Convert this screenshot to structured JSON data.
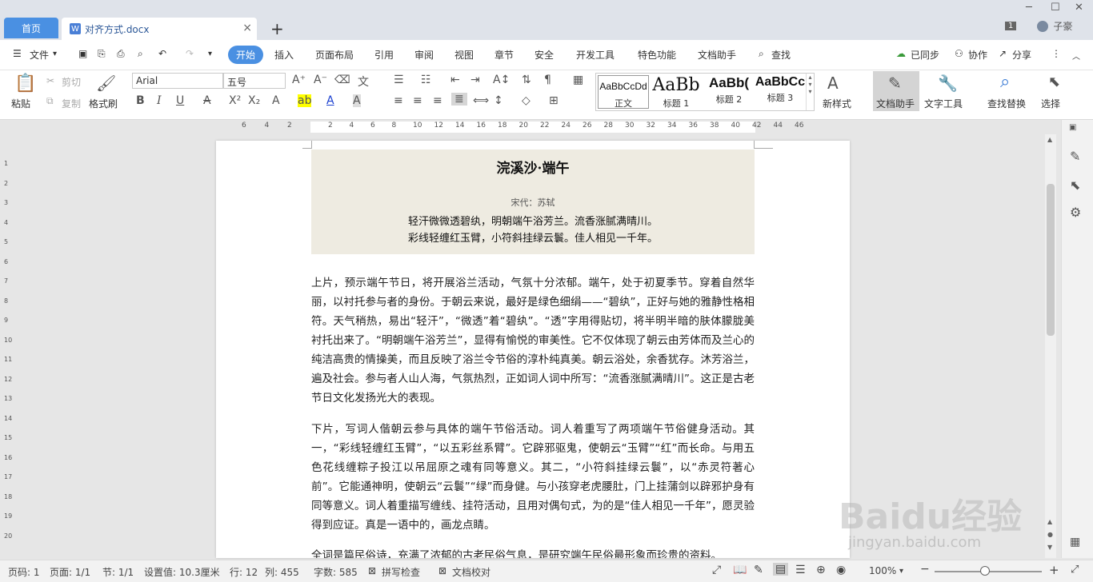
{
  "tabs": {
    "home": "首页",
    "doc": "对齐方式.docx",
    "close": "×",
    "plus": "+"
  },
  "window": {
    "badge": "1",
    "user": "子豪"
  },
  "menu": {
    "file": "文件",
    "items": [
      "开始",
      "插入",
      "页面布局",
      "引用",
      "审阅",
      "视图",
      "章节",
      "安全",
      "开发工具",
      "特色功能",
      "文档助手"
    ],
    "search": "查找",
    "sync": "已同步",
    "collab": "协作",
    "share": "分享"
  },
  "ribbon": {
    "paste": "粘贴",
    "cut": "剪切",
    "copy": "复制",
    "format_painter": "格式刷",
    "font": "Arial",
    "size": "五号",
    "styles": [
      {
        "preview": "AaBbCcDd",
        "label": "正文"
      },
      {
        "preview": "AaBb",
        "label": "标题 1"
      },
      {
        "preview": "AaBb(",
        "label": "标题 2"
      },
      {
        "preview": "AaBbCc",
        "label": "标题 3"
      }
    ],
    "new_style": "新样式",
    "doc_assistant": "文档助手",
    "text_tools": "文字工具",
    "find_replace": "查找替换",
    "select": "选择"
  },
  "ruler": {
    "h": [
      "6",
      "4",
      "2",
      "2",
      "4",
      "6",
      "8",
      "10",
      "12",
      "14",
      "16",
      "18",
      "20",
      "22",
      "24",
      "26",
      "28",
      "30",
      "32",
      "34",
      "36",
      "38",
      "40",
      "42",
      "44",
      "46"
    ],
    "v": [
      "1",
      "2",
      "3",
      "4",
      "5",
      "6",
      "7",
      "8",
      "9",
      "10",
      "11",
      "12",
      "13",
      "14",
      "15",
      "16",
      "17",
      "18",
      "19",
      "20"
    ]
  },
  "doc": {
    "title": "浣溪沙·端午",
    "author": "宋代：苏轼",
    "lines": [
      "轻汗微微透碧纨，明朝端午浴芳兰。流香涨腻满晴川。",
      "彩线轻缠红玉臂，小符斜挂绿云鬟。佳人相见一千年。"
    ],
    "p1": "上片，预示端午节日，将开展浴兰活动，气氛十分浓郁。端午，处于初夏季节。穿着自然华丽，以衬托参与者的身份。于朝云来说，最好是绿色细绢——“碧纨”，正好与她的雅静性格相符。天气稍热，易出“轻汗”，“微透”着“碧纨”。“透”字用得贴切，将半明半暗的肤体朦胧美衬托出来了。“明朝端午浴芳兰”，显得有愉悦的审美性。它不仅体现了朝云由芳体而及兰心的纯洁高贵的情操美，而且反映了浴兰令节俗的淳朴纯真美。朝云浴处，余香犹存。沐芳浴兰，遍及社会。参与者人山人海，气氛热烈，正如词人词中所写：“流香涨腻满晴川”。这正是古老节日文化发扬光大的表现。",
    "p2": "下片，写词人偕朝云参与具体的端午节俗活动。词人着重写了两项端午节俗健身活动。其一，“彩线轻缠红玉臂”，“以五彩丝系臂”。它辟邪驱鬼，使朝云“玉臂”“红”而长命。与用五色花线缠粽子投江以吊屈原之魂有同等意义。其二，“小符斜挂绿云鬟”，以“赤灵符著心前”。它能通神明，使朝云“云鬟”“绿”而身健。与小孩穿老虎腰肚，门上挂蒲剑以辟邪护身有同等意义。词人着重描写缠线、挂符活动，且用对偶句式，为的是“佳人相见一千年”，愿灵验得到应证。真是一语中的，画龙点睛。",
    "p3": "全词是篇民俗诗，充满了浓郁的古老民俗气息，是研究端午民俗最形象而珍贵的资料。"
  },
  "status": {
    "page": "页码: 1",
    "pages": "页面: 1/1",
    "section": "节: 1/1",
    "setting": "设置值: 10.3厘米",
    "row": "行: 12",
    "col": "列: 455",
    "words": "字数: 585",
    "spell": "拼写检查",
    "proof": "文档校对",
    "zoom": "100%"
  },
  "watermark": {
    "logo": "Baidu经验",
    "url": "jingyan.baidu.com"
  }
}
